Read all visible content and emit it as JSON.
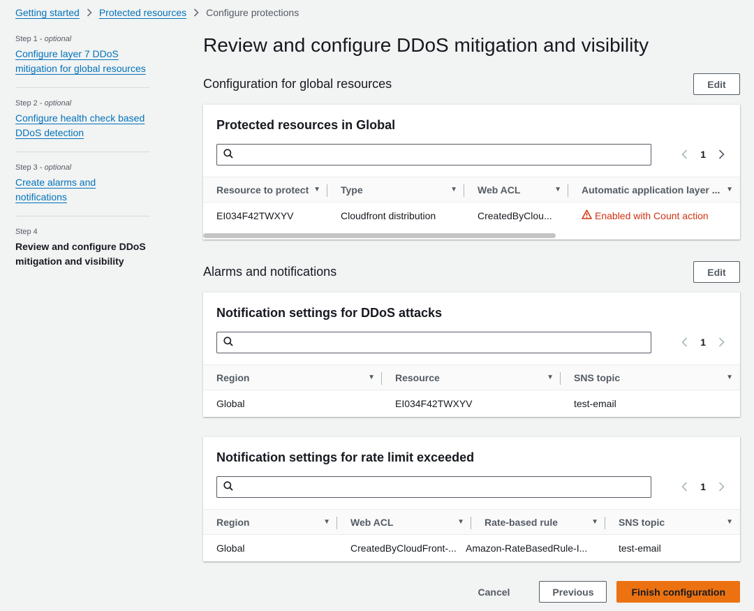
{
  "breadcrumb": {
    "items": [
      "Getting started",
      "Protected resources"
    ],
    "current": "Configure protections"
  },
  "steps": [
    {
      "label": "Step 1",
      "optional": "optional",
      "title": "Configure layer 7 DDoS mitigation for global resources"
    },
    {
      "label": "Step 2",
      "optional": "optional",
      "title": "Configure health check based DDoS detection"
    },
    {
      "label": "Step 3",
      "optional": "optional",
      "title": "Create alarms and notifications"
    },
    {
      "label": "Step 4",
      "optional": "",
      "title": "Review and configure DDoS mitigation and visibility"
    }
  ],
  "page": {
    "title": "Review and configure DDoS mitigation and visibility"
  },
  "global_config": {
    "title": "Configuration for global resources",
    "edit_label": "Edit",
    "panel_title": "Protected resources in Global",
    "search_placeholder": "",
    "page_number": "1",
    "columns": [
      "Resource to protect",
      "Type",
      "Web ACL",
      "Automatic application layer ..."
    ],
    "row": {
      "resource": "EI034F42TWXYV",
      "type": "Cloudfront distribution",
      "web_acl": "CreatedByClou...",
      "status": "Enabled with Count action"
    }
  },
  "alarms": {
    "title": "Alarms and notifications",
    "edit_label": "Edit",
    "ddos": {
      "panel_title": "Notification settings for DDoS attacks",
      "search_placeholder": "",
      "page_number": "1",
      "columns": [
        "Region",
        "Resource",
        "SNS topic"
      ],
      "row": {
        "region": "Global",
        "resource": "EI034F42TWXYV",
        "sns": "test-email"
      }
    },
    "rate": {
      "panel_title": "Notification settings for rate limit exceeded",
      "search_placeholder": "",
      "page_number": "1",
      "columns": [
        "Region",
        "Web ACL",
        "Rate-based rule",
        "SNS topic"
      ],
      "row": {
        "region": "Global",
        "web_acl": "CreatedByCloudFront-...",
        "rule": "Amazon-RateBasedRule-I...",
        "sns": "test-email"
      }
    }
  },
  "footer": {
    "cancel": "Cancel",
    "previous": "Previous",
    "finish": "Finish configuration"
  },
  "colors": {
    "link": "#0073bb",
    "primary": "#ec7211",
    "warning": "#d13212",
    "background": "#f2f3f3"
  }
}
